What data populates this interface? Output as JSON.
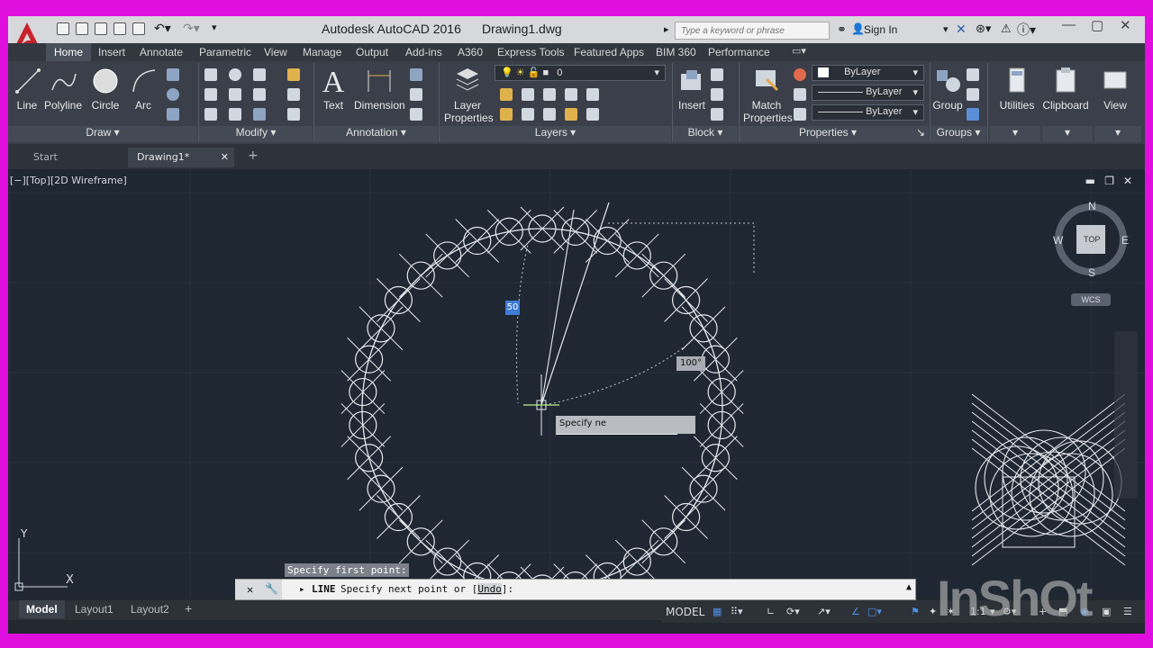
{
  "titlebar": {
    "app_title": "Autodesk AutoCAD 2016",
    "file_name": "Drawing1.dwg",
    "search_placeholder": "Type a keyword or phrase",
    "sign_in": "Sign In"
  },
  "tabs": [
    "Home",
    "Insert",
    "Annotate",
    "Parametric",
    "View",
    "Manage",
    "Output",
    "Add-ins",
    "A360",
    "Express Tools",
    "Featured Apps",
    "BIM 360",
    "Performance"
  ],
  "ribbon": {
    "draw": {
      "line": "Line",
      "polyline": "Polyline",
      "circle": "Circle",
      "arc": "Arc",
      "panel": "Draw"
    },
    "modify": {
      "panel": "Modify"
    },
    "annotation": {
      "text": "Text",
      "dimension": "Dimension",
      "panel": "Annotation"
    },
    "layers": {
      "layer_properties_1": "Layer",
      "layer_properties_2": "Properties",
      "current_layer": "0",
      "panel": "Layers"
    },
    "block": {
      "insert": "Insert",
      "panel": "Block"
    },
    "properties": {
      "match_1": "Match",
      "match_2": "Properties",
      "color": "ByLayer",
      "linetype": "ByLayer",
      "lineweight": "ByLayer",
      "panel": "Properties"
    },
    "groups": {
      "group": "Group",
      "panel": "Groups"
    },
    "utilities": "Utilities",
    "clipboard": "Clipboard",
    "view": "View"
  },
  "filetabs": {
    "start": "Start",
    "drawing": "Drawing1*"
  },
  "viewport": {
    "label": "[−][Top][2D Wireframe]",
    "dyn_length": "50",
    "dyn_angle": "100°",
    "tooltip": "Specify ne",
    "compass": {
      "n": "N",
      "s": "S",
      "e": "E",
      "w": "W",
      "top": "TOP",
      "wcs": "WCS"
    },
    "ucs": {
      "x": "X",
      "y": "Y"
    }
  },
  "command": {
    "history": "Specify first point:",
    "prompt_cmd": "LINE",
    "prompt_text": "Specify next point or [",
    "prompt_option": "Undo",
    "prompt_end": "]:"
  },
  "layouts": {
    "model": "Model",
    "layout1": "Layout1",
    "layout2": "Layout2"
  },
  "status": {
    "model": "MODEL",
    "scale": "1:1"
  },
  "watermark": "InShOt",
  "colors": {
    "frame": "#e10ee0",
    "canvas": "#1f2732",
    "ribbon": "#3a3f49",
    "accent": "#c0392b"
  }
}
